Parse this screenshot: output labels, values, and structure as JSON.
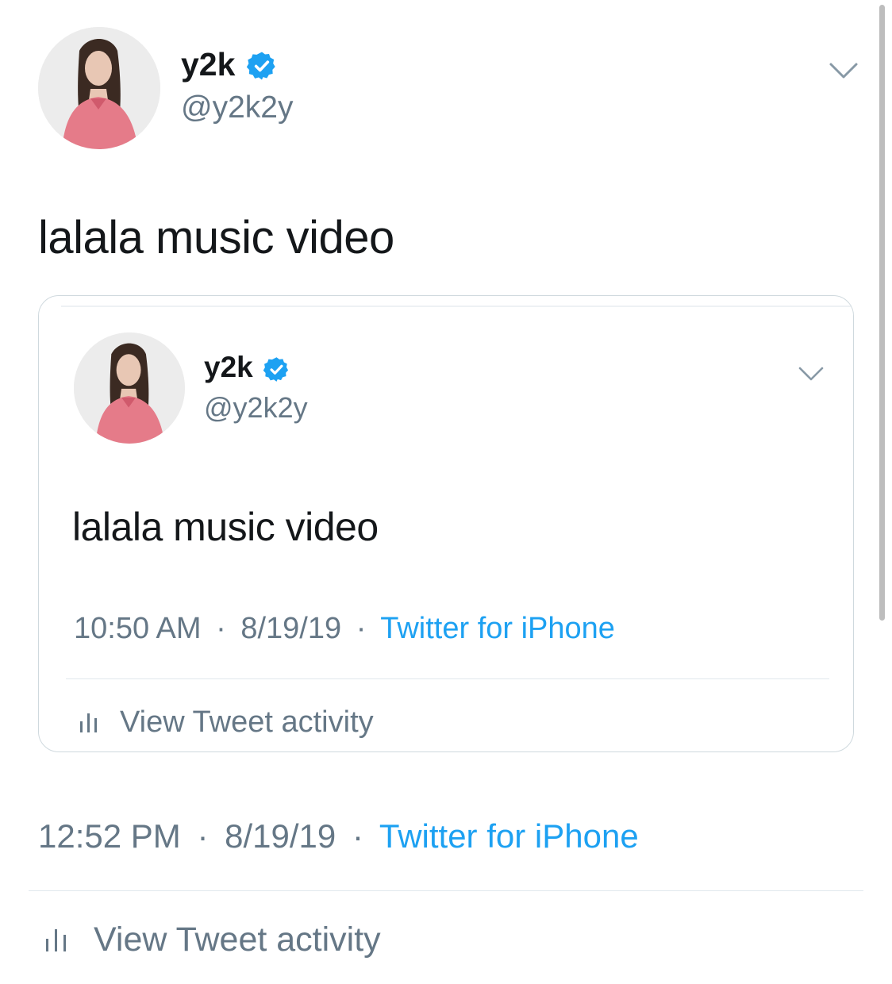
{
  "tweet": {
    "name": "y2k",
    "handle": "@y2k2y",
    "text": "lalala music video",
    "time": "12:52 PM",
    "date": "8/19/19",
    "separator": "·",
    "source": "Twitter for iPhone",
    "activity_label": "View Tweet activity"
  },
  "quoted_tweet": {
    "name": "y2k",
    "handle": "@y2k2y",
    "text": "lalala music video",
    "time": "10:50 AM",
    "date": "8/19/19",
    "separator": "·",
    "source": "Twitter for iPhone",
    "activity_label": "View Tweet activity"
  },
  "icons": {
    "verified": "verified-badge-icon",
    "menu": "chevron-down-icon",
    "activity": "bar-chart-icon"
  },
  "colors": {
    "text": "#14171a",
    "secondary": "#657786",
    "link": "#1da1f2",
    "verified": "#1da1f2",
    "divider": "#e1e8ed"
  }
}
